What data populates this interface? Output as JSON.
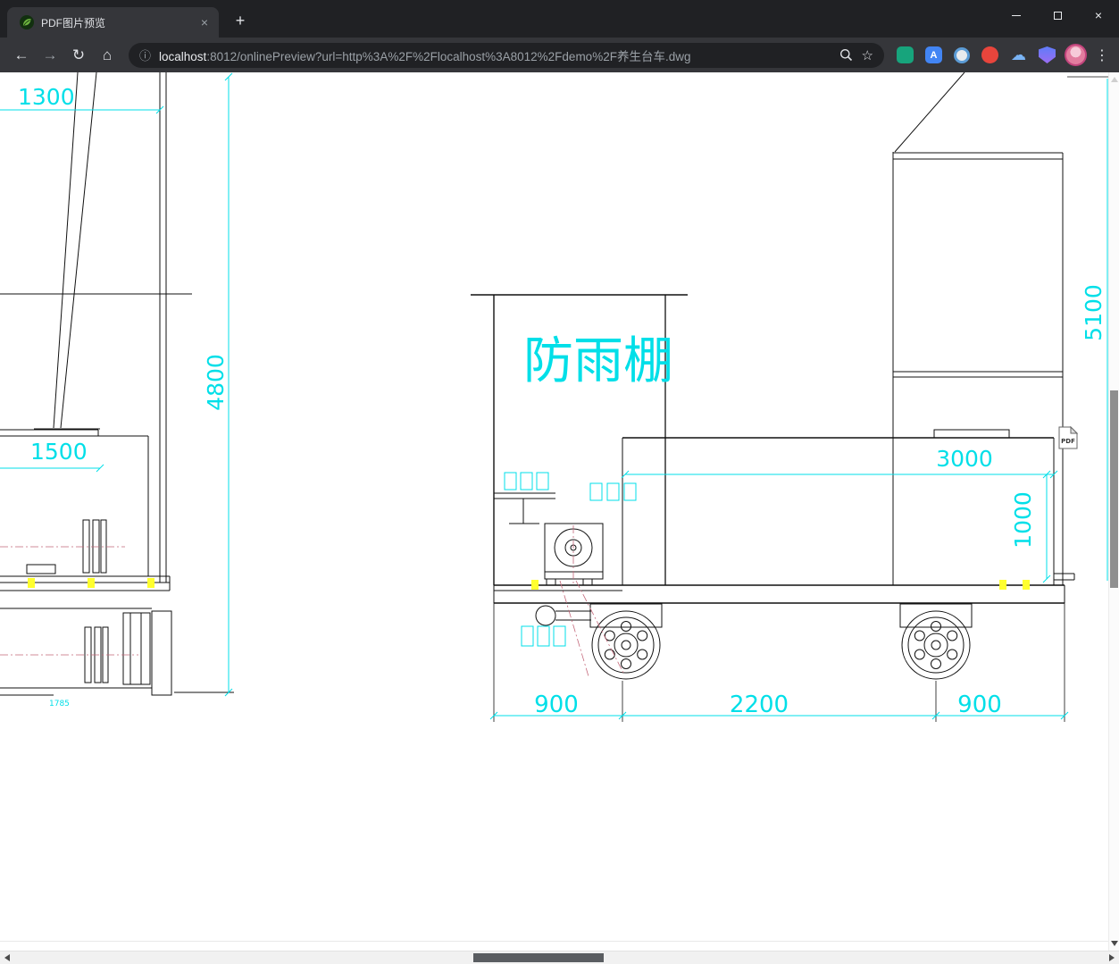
{
  "browser": {
    "tab_title": "PDF图片预览",
    "address_host": "localhost",
    "address_path": ":8012/onlinePreview?url=http%3A%2F%2Flocalhost%3A8012%2Fdemo%2F养生台车.dwg",
    "icons": {
      "tab_close": "×",
      "window_close": "×",
      "plus": "+",
      "back": "←",
      "forward": "→",
      "reload": "↻",
      "home": "⌂",
      "info": "ⓘ",
      "star": "☆",
      "menu": "⋮",
      "cloud": "☁",
      "translate": "A"
    }
  },
  "drawing": {
    "shelter_label": "防雨棚",
    "dim_1300": "1300",
    "dim_4800": "4800",
    "dim_1500": "1500",
    "dim_1785": "1785",
    "dim_5100": "5100",
    "dim_3000": "3000",
    "dim_1000": "1000",
    "dim_900_left": "900",
    "dim_2200": "2200",
    "dim_900_right": "900",
    "pdf_badge": "PDF",
    "colors": {
      "dimension": "#00dfe8",
      "highlight": "#ffff00",
      "line": "#111111"
    }
  }
}
